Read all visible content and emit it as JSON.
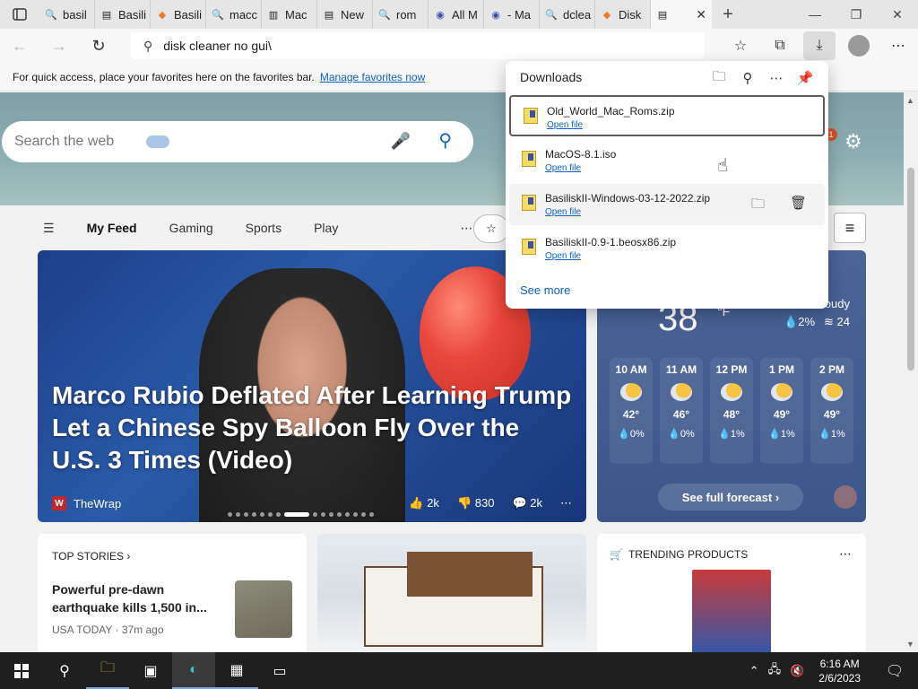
{
  "tabs": [
    {
      "label": "basil",
      "icon": "search-icon"
    },
    {
      "label": "Basili",
      "icon": "page-icon"
    },
    {
      "label": "Basili",
      "icon": "diamond-icon"
    },
    {
      "label": "macc",
      "icon": "search-icon"
    },
    {
      "label": "Mac",
      "icon": "book-icon"
    },
    {
      "label": "New",
      "icon": "page-icon"
    },
    {
      "label": "rom",
      "icon": "search-icon"
    },
    {
      "label": "All M",
      "icon": "globe-icon"
    },
    {
      "label": "- Ma",
      "icon": "globe-icon"
    },
    {
      "label": "dclea",
      "icon": "search-icon"
    },
    {
      "label": "Disk",
      "icon": "diamond-icon"
    },
    {
      "label": "",
      "icon": "page-icon",
      "active": true
    }
  ],
  "address_bar": {
    "value": "disk cleaner no gui\\"
  },
  "favorites_bar": {
    "text": "For quick access, place your favorites here on the favorites bar.",
    "link": "Manage favorites now"
  },
  "search": {
    "placeholder": "Search the web"
  },
  "notification_count": "1",
  "feed_nav": [
    "My Feed",
    "Gaming",
    "Sports",
    "Play"
  ],
  "hero": {
    "title": "Marco Rubio Deflated After Learning Trump Let a Chinese Spy Balloon Fly Over the U.S. 3 Times (Video)",
    "source": "TheWrap",
    "source_logo": "W",
    "likes": "2k",
    "dislikes": "830",
    "comments": "2k"
  },
  "weather": {
    "temp": "38",
    "unit": "°F",
    "condition": "oudy",
    "precip": "2%",
    "humidity": "24",
    "hours": [
      {
        "time": "10 AM",
        "temp": "42°",
        "precip": "0%"
      },
      {
        "time": "11 AM",
        "temp": "46°",
        "precip": "0%"
      },
      {
        "time": "12 PM",
        "temp": "48°",
        "precip": "1%"
      },
      {
        "time": "1 PM",
        "temp": "49°",
        "precip": "1%"
      },
      {
        "time": "2 PM",
        "temp": "49°",
        "precip": "1%"
      }
    ],
    "forecast_label": "See full forecast"
  },
  "top_stories": {
    "header": "TOP STORIES",
    "headline": "Powerful pre-dawn earthquake kills 1,500 in...",
    "source": "USA TODAY",
    "age": "37m ago"
  },
  "trending": {
    "header": "TRENDING PRODUCTS"
  },
  "downloads": {
    "title": "Downloads",
    "items": [
      {
        "name": "Old_World_Mac_Roms.zip",
        "action": "Open file"
      },
      {
        "name": "MacOS-8.1.iso",
        "action": "Open file"
      },
      {
        "name": "BasiliskII-Windows-03-12-2022.zip",
        "action": "Open file"
      },
      {
        "name": "BasiliskII-0.9-1.beosx86.zip",
        "action": "Open file"
      }
    ],
    "see_more": "See more"
  },
  "clock": {
    "time": "6:16 AM",
    "date": "2/6/2023"
  },
  "colors": {
    "accent": "#0b62c4",
    "taskbar": "#1f1f1f",
    "weather_bg": "#4a6496"
  }
}
